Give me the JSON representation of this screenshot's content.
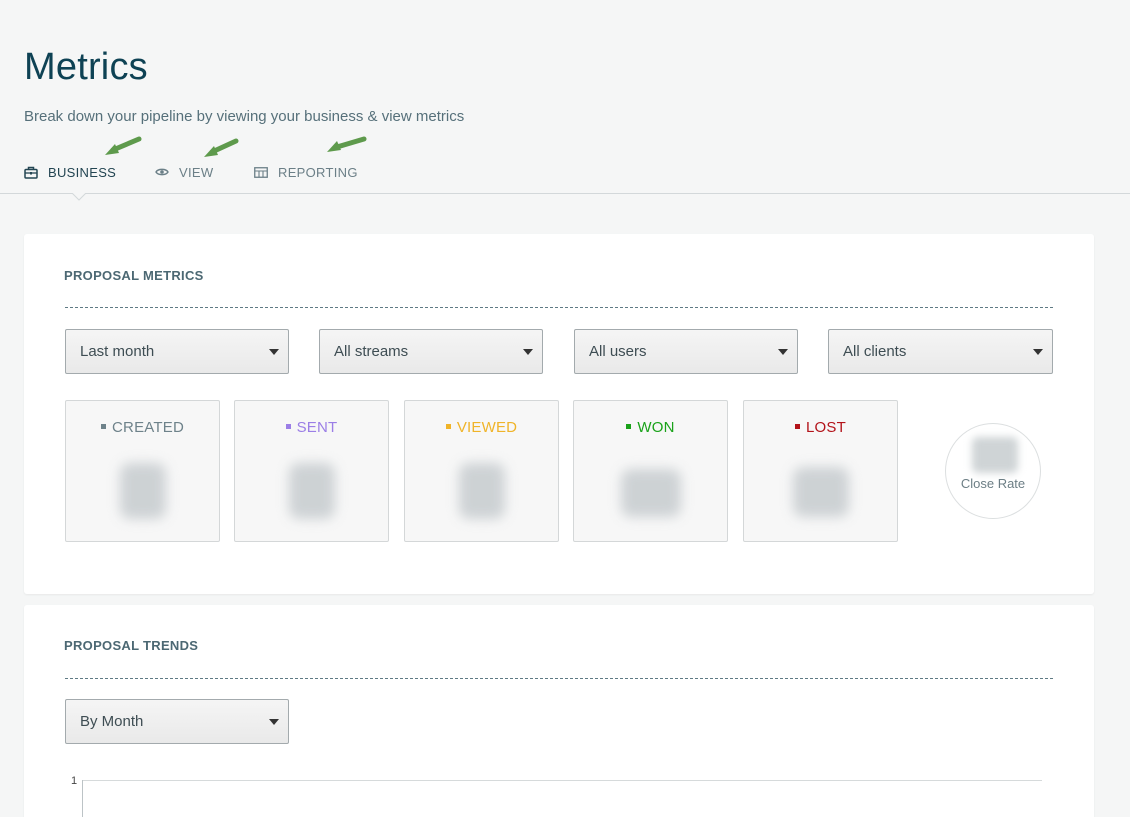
{
  "header": {
    "title": "Metrics",
    "subtitle": "Break down your pipeline by viewing your business & view metrics"
  },
  "tabs": [
    {
      "label": "BUSINESS",
      "icon": "briefcase-icon",
      "active": true
    },
    {
      "label": "VIEW",
      "icon": "eye-icon",
      "active": false
    },
    {
      "label": "REPORTING",
      "icon": "table-icon",
      "active": false
    }
  ],
  "annotations": {
    "arrow_color": "#5e9a4c",
    "arrow_icon": "arrow-pointer-icon"
  },
  "proposal_metrics": {
    "title": "PROPOSAL METRICS",
    "filters": [
      {
        "value": "Last month"
      },
      {
        "value": "All streams"
      },
      {
        "value": "All users"
      },
      {
        "value": "All clients"
      }
    ],
    "stats": [
      {
        "label": "CREATED",
        "color": "#6e828a"
      },
      {
        "label": "SENT",
        "color": "#9b7ee6"
      },
      {
        "label": "VIEWED",
        "color": "#f0b429"
      },
      {
        "label": "WON",
        "color": "#1aa21a"
      },
      {
        "label": "LOST",
        "color": "#b3131a"
      }
    ],
    "close_rate_label": "Close Rate"
  },
  "proposal_trends": {
    "title": "PROPOSAL TRENDS",
    "group_by": "By Month",
    "y_tick_top": "1"
  }
}
